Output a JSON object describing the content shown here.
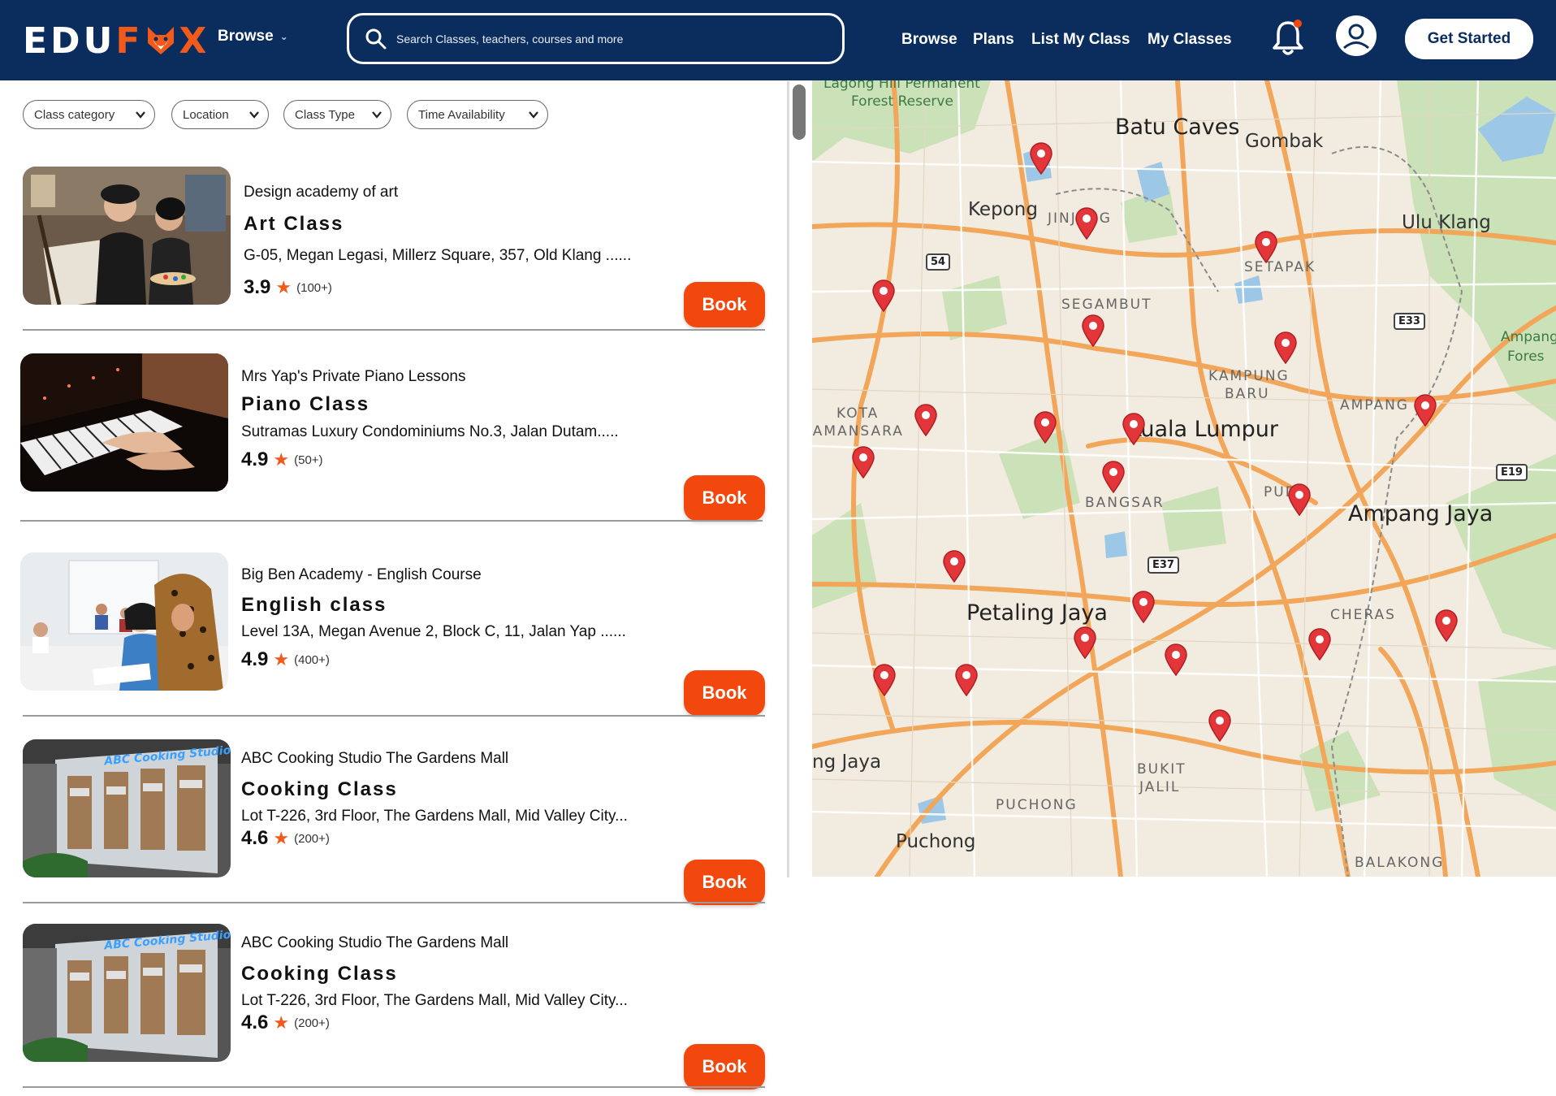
{
  "header": {
    "logo": {
      "left": "EDU",
      "accent": "F",
      "right": "X"
    },
    "browse_label": "Browse",
    "search_placeholder": "Search Classes, teachers, courses and more",
    "nav": [
      "Browse",
      "Plans",
      "List My Class",
      "My Classes"
    ],
    "get_started": "Get Started"
  },
  "filters": [
    "Class category",
    "Location",
    "Class Type",
    "Time Availability"
  ],
  "listings": [
    {
      "provider": "Design academy of art",
      "title": "Art Class",
      "address": "G-05, Megan Legasi, Millerz Square, 357, Old Klang ......",
      "rating": "3.9",
      "count": "(100+)",
      "book": "Book",
      "thumb": "art"
    },
    {
      "provider": "Mrs Yap's Private Piano Lessons",
      "title": "Piano Class",
      "address": "Sutramas Luxury Condominiums No.3, Jalan Dutam.....",
      "rating": "4.9",
      "count": "(50+)",
      "book": "Book",
      "thumb": "piano"
    },
    {
      "provider": "Big Ben Academy - English Course",
      "title": "English class",
      "address": "Level 13A, Megan Avenue 2, Block C, 11, Jalan Yap ......",
      "rating": "4.9",
      "count": "(400+)",
      "book": "Book",
      "thumb": "english"
    },
    {
      "provider": "ABC Cooking Studio The Gardens Mall",
      "title": "Cooking Class",
      "address": "Lot T-226, 3rd Floor, The Gardens Mall, Mid Valley City...",
      "rating": "4.6",
      "count": "(200+)",
      "book": "Book",
      "thumb": "cooking"
    },
    {
      "provider": "ABC Cooking Studio The Gardens Mall",
      "title": "Cooking Class",
      "address": "Lot T-226, 3rd Floor, The Gardens Mall, Mid Valley City...",
      "rating": "4.6",
      "count": "(200+)",
      "book": "Book",
      "thumb": "cooking"
    }
  ],
  "map": {
    "labels_big": [
      "Batu Caves",
      "Gombak",
      "Kuala Lumpur",
      "Petaling Jaya",
      "Ampang Jaya",
      "Puchong"
    ],
    "labels_mid": [
      "Kepong",
      "Ulu Klang",
      "ng Jaya"
    ],
    "labels_small": [
      "JINJANG",
      "SETAPAK",
      "SEGAMBUT",
      "KAMPUNG",
      "BARU",
      "KOTA",
      "DAMANSARA",
      "AMPANG",
      "BANGSAR",
      "PUDU",
      "CHERAS",
      "BUKIT",
      "JALIL",
      "PUCHONG",
      "BALAKONG"
    ],
    "labels_green": [
      "Lagong Hill Permanent",
      "Forest Reserve",
      "Ampang",
      "Fores"
    ],
    "shields": [
      "54",
      "E33",
      "E19",
      "E37"
    ]
  },
  "colors": {
    "navy": "#0a2d5e",
    "accent": "#f2480e",
    "pin": "#e2363a"
  }
}
